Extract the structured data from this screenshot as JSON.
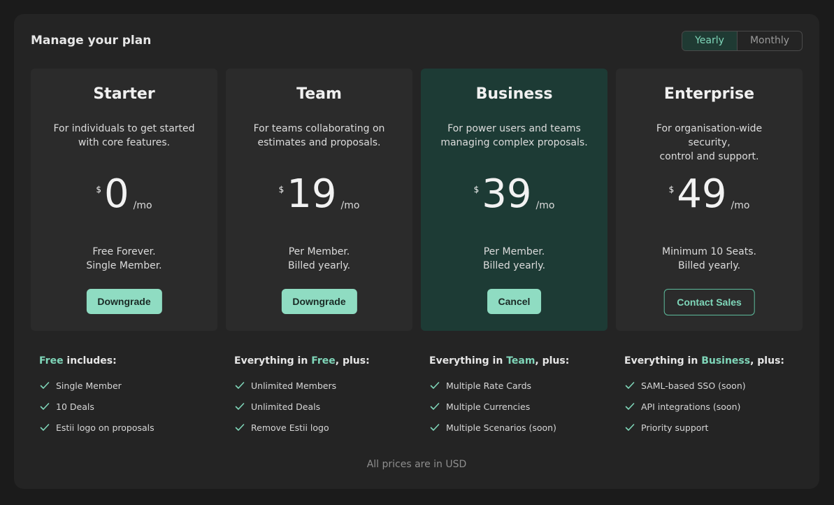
{
  "header": {
    "title": "Manage your plan",
    "toggle": {
      "yearly": "Yearly",
      "monthly": "Monthly",
      "selected": "Yearly"
    }
  },
  "plans": [
    {
      "name": "Starter",
      "desc_line1": "For individuals to get started",
      "desc_line2": "with core features.",
      "currency": "$",
      "amount": "0",
      "period": "/mo",
      "note_line1": "Free Forever.",
      "note_line2": "Single Member.",
      "button": "Downgrade"
    },
    {
      "name": "Team",
      "desc_line1": "For teams collaborating on",
      "desc_line2": "estimates and proposals.",
      "currency": "$",
      "amount": "19",
      "period": "/mo",
      "note_line1": "Per Member.",
      "note_line2": "Billed yearly.",
      "button": "Downgrade"
    },
    {
      "name": "Business",
      "desc_line1": "For power users and teams",
      "desc_line2": "managing complex proposals.",
      "currency": "$",
      "amount": "39",
      "period": "/mo",
      "note_line1": "Per Member.",
      "note_line2": "Billed yearly.",
      "button": "Cancel"
    },
    {
      "name": "Enterprise",
      "desc_line1": "For organisation-wide security,",
      "desc_line2": "control and support.",
      "currency": "$",
      "amount": "49",
      "period": "/mo",
      "note_line1": "Minimum 10 Seats.",
      "note_line2": "Billed yearly.",
      "button": "Contact Sales"
    }
  ],
  "features": [
    {
      "head_pre": "",
      "head_accent": "Free",
      "head_post": " includes:",
      "items": [
        "Single Member",
        "10 Deals",
        "Estii logo on proposals"
      ]
    },
    {
      "head_pre": "Everything in ",
      "head_accent": "Free",
      "head_post": ", plus:",
      "items": [
        "Unlimited Members",
        "Unlimited Deals",
        "Remove Estii logo"
      ]
    },
    {
      "head_pre": "Everything in ",
      "head_accent": "Team",
      "head_post": ", plus:",
      "items": [
        "Multiple Rate Cards",
        "Multiple Currencies",
        "Multiple Scenarios (soon)"
      ]
    },
    {
      "head_pre": "Everything in ",
      "head_accent": "Business",
      "head_post": ", plus:",
      "items": [
        "SAML-based SSO (soon)",
        "API integrations (soon)",
        "Priority support"
      ]
    }
  ],
  "footer": {
    "text": "All prices are in USD"
  },
  "colors": {
    "accent": "#7fd6b9",
    "button": "#8fdcc2",
    "highlight": "#1d3b35"
  }
}
